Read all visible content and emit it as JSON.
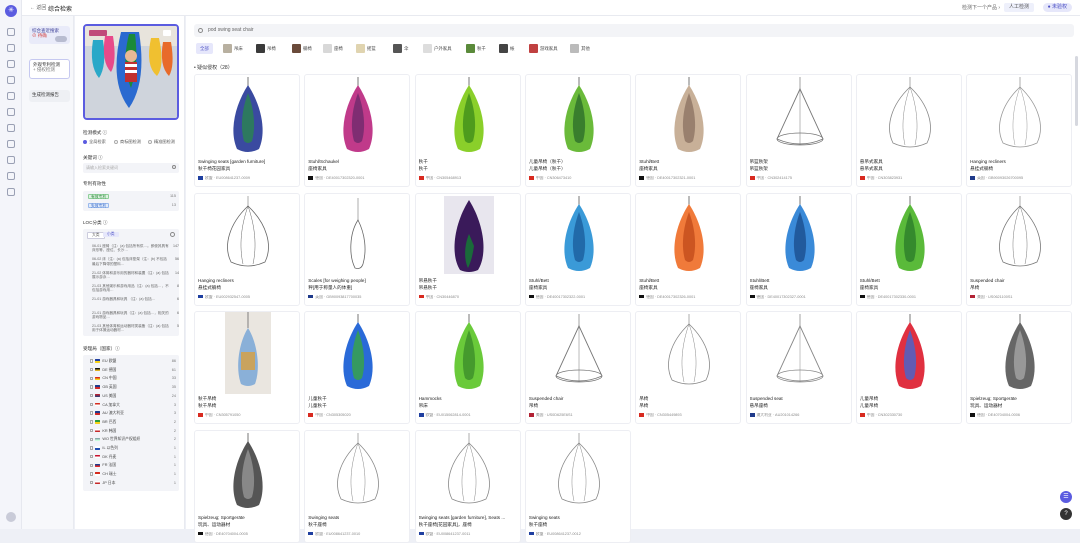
{
  "topbar": {
    "back": "← 返回",
    "title": "综合检索",
    "next": "检测下一个产品 ›",
    "manual": "人工检测",
    "trial": "● 未验权"
  },
  "subnav": [
    {
      "label": "综合查近搜索",
      "sub": "⊘ 待确",
      "kind": "a"
    },
    {
      "label": "外观专利检测",
      "sub": "+ 侵权检测",
      "kind": "b"
    },
    {
      "label": "生成检测报告",
      "sub": "",
      "kind": "c"
    }
  ],
  "filter": {
    "mode_label": "检测模式 ⓘ",
    "modes": [
      "全局检索",
      "商标图检测",
      "精准图检测"
    ],
    "keyword_label": "关键词 ⓘ",
    "keyword_placeholder": "请输入检索关键词",
    "status_label": "专利有效性",
    "status": [
      {
        "tag": "有效专利",
        "count": "115",
        "cls": "g"
      },
      {
        "tag": "失效专利",
        "count": "13",
        "cls": "b"
      }
    ],
    "loc_label": "LOC分类 ⓘ",
    "loc_chips": [
      "大类",
      "小类"
    ],
    "loc_rows": [
      {
        "text": "06-01 座椅（注：(a) 包括所有供…。即使其具有床形等，座位、长沙…",
        "n": "147"
      },
      {
        "text": "06-02 床（注：(a) 包括床垫架（注：(b) 不包括最后下降带的塑料…",
        "n": "56"
      },
      {
        "text": "21-02 体育和游乐用的器材和装置（注：(a) 包括展示游泳…",
        "n": "14"
      },
      {
        "text": "21-03 其他娱乐和游戏用品（注：(a) 包括…，不包括游戏用…",
        "n": "8"
      },
      {
        "text": "21-01 游戏器具和玩具 （注：(a) 包括…",
        "n": "6"
      },
      {
        "text": "21-01 游戏器具和玩具（注：(a) 包括…，相关的游戏物品…",
        "n": "6"
      },
      {
        "text": "21-03 其他体育和运动器材类装备（注：(a) 包括用于体操运动器材…",
        "n": "5"
      }
    ],
    "country_label": "受理局（国家）ⓘ",
    "countries": [
      {
        "name": "EU 欧盟",
        "n": "86",
        "c1": "#1f3fa0",
        "c2": "#f7d21a"
      },
      {
        "name": "DE 德国",
        "n": "61",
        "c1": "#111",
        "c2": "#e0b020"
      },
      {
        "name": "CN 中国",
        "n": "33",
        "c1": "#d82a20",
        "c2": "#f7d21a"
      },
      {
        "name": "GB 英国",
        "n": "35",
        "c1": "#1f3a8a",
        "c2": "#d02828"
      },
      {
        "name": "US 美国",
        "n": "24",
        "c1": "#b22234",
        "c2": "#3c3b6e"
      },
      {
        "name": "CA 加拿大",
        "n": "3",
        "c1": "#d52b1e",
        "c2": "#fff"
      },
      {
        "name": "AU 澳大利亚",
        "n": "3",
        "c1": "#1f3a8a",
        "c2": "#d02828"
      },
      {
        "name": "BR 巴西",
        "n": "2",
        "c1": "#2a9a3a",
        "c2": "#f7d21a"
      },
      {
        "name": "KR 韩国",
        "n": "2",
        "c1": "#fff",
        "c2": "#c62828"
      },
      {
        "name": "WO 世界知识产权组织",
        "n": "2",
        "c1": "#8aa",
        "c2": "#cfd"
      },
      {
        "name": "IL 以色列",
        "n": "1",
        "c1": "#fff",
        "c2": "#1f4fb0"
      },
      {
        "name": "DK 丹麦",
        "n": "1",
        "c1": "#c8102e",
        "c2": "#fff"
      },
      {
        "name": "FR 法国",
        "n": "1",
        "c1": "#1f3a8a",
        "c2": "#e02828"
      },
      {
        "name": "CH 瑞士",
        "n": "1",
        "c1": "#d52b1e",
        "c2": "#fff"
      },
      {
        "name": "JP 日本",
        "n": "1",
        "c1": "#fff",
        "c2": "#c62828"
      }
    ]
  },
  "search": {
    "query": "pod swing seat chair"
  },
  "categories": [
    {
      "label": "全部",
      "sel": true,
      "col": ""
    },
    {
      "label": "吊床",
      "col": "#b8b0a0"
    },
    {
      "label": "吊椅",
      "col": "#3a3a3a"
    },
    {
      "label": "躺椅",
      "col": "#6a4a3a"
    },
    {
      "label": "座椅",
      "col": "#d8d8d8"
    },
    {
      "label": "摇篮",
      "col": "#e0d4b0"
    },
    {
      "label": "伞",
      "col": "#555"
    },
    {
      "label": "户外家具",
      "col": "#ddd"
    },
    {
      "label": "秋千",
      "col": "#5a8a3a"
    },
    {
      "label": "帐",
      "col": "#444"
    },
    {
      "label": "游戏家具",
      "col": "#c04040"
    },
    {
      "label": "其他",
      "col": "#bbb"
    }
  ],
  "results_header": "• 疑似侵权（28）",
  "cards": [
    {
      "t1": "Swinging seats [garden furniture]",
      "t2": "秋千椅花园家具",
      "t3": "欧盟 · EU008641237-0009",
      "flag": "#1f3fa0",
      "kind": "pod",
      "c1": "#3a4aa0",
      "c2": "#2a8a4a"
    },
    {
      "t1": "Stuhl/Schaukel",
      "t2": "座椅家具",
      "t3": "德国 · DE40017302320-0001",
      "flag": "#111",
      "kind": "pod",
      "c1": "#c03a8a",
      "c2": "#6a2a6a"
    },
    {
      "t1": "秋千",
      "t2": "秋千",
      "t3": "中国 · CN305468913",
      "flag": "#d82a20",
      "kind": "pod",
      "c1": "#8acf2a",
      "c2": "#3a8a1a"
    },
    {
      "t1": "儿童吊椅（秋千）",
      "t2": "儿童吊椅（秋千）",
      "t3": "中国 · CN306473410",
      "flag": "#d82a20",
      "kind": "pod",
      "c1": "#6aba3a",
      "c2": "#2a6a2a"
    },
    {
      "t1": "Stuhl/Bett",
      "t2": "座椅家具",
      "t3": "德国 · DE40017302321-0001",
      "flag": "#111",
      "kind": "pod",
      "c1": "#c8b098",
      "c2": "#8a7060"
    },
    {
      "t1": "吊篮秋架",
      "t2": "吊篮秋架",
      "t3": "中国 · CN302414175",
      "flag": "#d82a20",
      "kind": "tri",
      "c1": "#777",
      "c2": "#777"
    },
    {
      "t1": "悬吊式家具",
      "t2": "悬吊式家具",
      "t3": "中国 · CN303823931",
      "flag": "#d82a20",
      "kind": "wire",
      "c1": "#888",
      "c2": "#888"
    },
    {
      "t1": "Hanging recliners",
      "t2": "悬挂式躺椅",
      "t3": "英国 · GB90093026700095",
      "flag": "#1f3a8a",
      "kind": "wire",
      "c1": "#999",
      "c2": "#999"
    },
    {
      "t1": "Hanging recliners",
      "t2": "悬挂式躺椅",
      "t3": "欧盟 · EU002932547-0005",
      "flag": "#1f3fa0",
      "kind": "wire",
      "c1": "#666",
      "c2": "#666"
    },
    {
      "t1": "Scales [for weighing people]",
      "t2": "秤[用于称量人的体重]",
      "t3": "英国 · GB90093817700035",
      "flag": "#1f3a8a",
      "kind": "line",
      "c1": "#666",
      "c2": "#666"
    },
    {
      "t1": "吊悬秋千",
      "t2": "吊悬秋千",
      "t3": "中国 · CN30446870",
      "flag": "#d82a20",
      "kind": "dark",
      "c1": "#3a1a5a",
      "c2": "#1a6a3a"
    },
    {
      "t1": "Stuhl/Bett",
      "t2": "座椅家具",
      "t3": "德国 · DE40017302322-0001",
      "flag": "#111",
      "kind": "pod",
      "c1": "#3a9ad8",
      "c2": "#1a5a9a"
    },
    {
      "t1": "Stuhl/Bett",
      "t2": "座椅家具",
      "t3": "德国 · DE40017302326-0001",
      "flag": "#111",
      "kind": "pod",
      "c1": "#f07a3a",
      "c2": "#c04a1a"
    },
    {
      "t1": "Stuhl/Bett",
      "t2": "座椅家具",
      "t3": "德国 · DE40017302327-0001",
      "flag": "#111",
      "kind": "pod",
      "c1": "#3a8ad8",
      "c2": "#1a4a8a"
    },
    {
      "t1": "Stuhl/Bett",
      "t2": "座椅家具",
      "t3": "德国 · DE40017302330-0001",
      "flag": "#111",
      "kind": "pod",
      "c1": "#5aba3a",
      "c2": "#2a7a2a"
    },
    {
      "t1": "Suspended chair",
      "t2": "吊椅",
      "t3": "美国 · US0621100S1",
      "flag": "#b22234",
      "kind": "wire",
      "c1": "#777",
      "c2": "#777"
    },
    {
      "t1": "秋千吊椅",
      "t2": "秋千吊椅",
      "t3": "中国 · CN305791050",
      "flag": "#d82a20",
      "kind": "photo",
      "c1": "#8ab0d8",
      "c2": "#d8a040"
    },
    {
      "t1": "儿童秋千",
      "t2": "儿童秋千",
      "t3": "中国 · CN305305020",
      "flag": "#d82a20",
      "kind": "pod",
      "c1": "#2a6ad8",
      "c2": "#3aaa3a"
    },
    {
      "t1": "Hammocks",
      "t2": "吊床",
      "t3": "欧盟 · EU015062814-0001",
      "flag": "#1f3fa0",
      "kind": "pod",
      "c1": "#6aca3a",
      "c2": "#3a8a2a"
    },
    {
      "t1": "Suspended chair",
      "t2": "吊椅",
      "t3": "美国 · US0D625E6S1",
      "flag": "#b22234",
      "kind": "tri",
      "c1": "#777",
      "c2": "#777"
    },
    {
      "t1": "吊椅",
      "t2": "吊椅",
      "t3": "中国 · CN305449893",
      "flag": "#d82a20",
      "kind": "wire",
      "c1": "#888",
      "c2": "#888"
    },
    {
      "t1": "Suspended seat",
      "t2": "悬吊座椅",
      "t3": "澳大利亚 · AU201014266",
      "flag": "#1f3a8a",
      "kind": "tri",
      "c1": "#888",
      "c2": "#888"
    },
    {
      "t1": "儿童吊椅",
      "t2": "儿童吊椅",
      "t3": "中国 · CN302330730",
      "flag": "#d82a20",
      "kind": "pod",
      "c1": "#e03040",
      "c2": "#3a6ad8"
    },
    {
      "t1": "Spielzeug; Sportgeräte",
      "t2": "玩具、运动器材",
      "t3": "德国 · DE40704004-0006",
      "flag": "#111",
      "kind": "pod",
      "c1": "#666",
      "c2": "#aaa"
    },
    {
      "t1": "Spielzeug; Sportgeräte",
      "t2": "玩具、运动器材",
      "t3": "德国 · DE40704004-0005",
      "flag": "#111",
      "kind": "pod",
      "c1": "#555",
      "c2": "#999"
    },
    {
      "t1": "Swinging seats",
      "t2": "秋千座椅",
      "t3": "欧盟 · EU008641237-0010",
      "flag": "#1f3fa0",
      "kind": "wire",
      "c1": "#888",
      "c2": "#888"
    },
    {
      "t1": "Swinging seats [garden furniture], Seats ...",
      "t2": "秋千座椅[花园家具]，座椅",
      "t3": "欧盟 · EU008641237-0011",
      "flag": "#1f3fa0",
      "kind": "wire",
      "c1": "#888",
      "c2": "#888"
    },
    {
      "t1": "Swinging seats",
      "t2": "秋千座椅",
      "t3": "欧盟 · EU008641237-0012",
      "flag": "#1f3fa0",
      "kind": "wire",
      "c1": "#888",
      "c2": "#888"
    }
  ]
}
